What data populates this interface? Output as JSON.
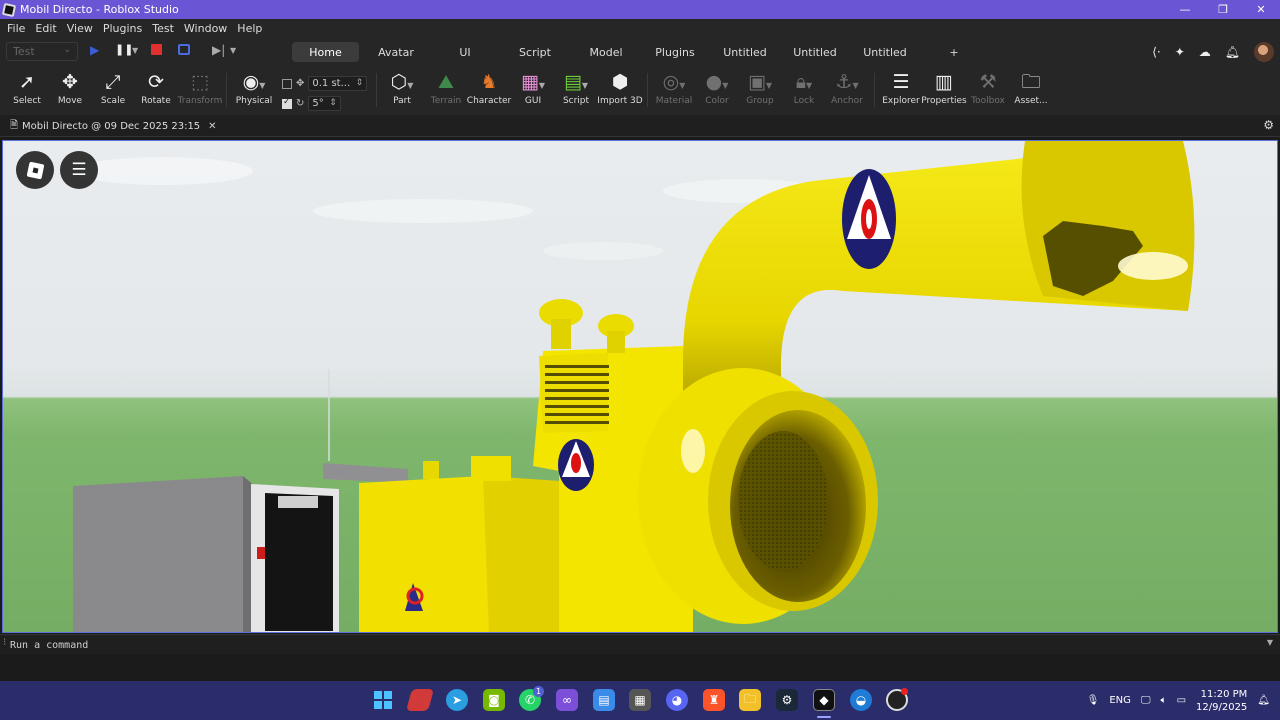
{
  "window": {
    "title": "Mobil Directo - Roblox Studio",
    "controls": {
      "minimize": "—",
      "maximize": "❐",
      "close": "✕"
    }
  },
  "menu": [
    "File",
    "Edit",
    "View",
    "Plugins",
    "Test",
    "Window",
    "Help"
  ],
  "tabbar": {
    "test_select": "Test",
    "tabs": [
      "Home",
      "Avatar",
      "UI",
      "Script",
      "Model",
      "Plugins",
      "Untitled",
      "Untitled",
      "Untitled"
    ],
    "active_tab": "Home",
    "add_tab": "+"
  },
  "toolbar": {
    "select": "Select",
    "move": "Move",
    "scale": "Scale",
    "rotate": "Rotate",
    "transform": "Transform",
    "physical": "Physical",
    "move_increment": "0.1 st...",
    "rotate_increment": "5°",
    "part": "Part",
    "terrain": "Terrain",
    "character": "Character",
    "gui": "GUI",
    "script": "Script",
    "import3d": "Import 3D",
    "material": "Material",
    "color": "Color",
    "group": "Group",
    "lock": "Lock",
    "anchor": "Anchor",
    "explorer": "Explorer",
    "properties": "Properties",
    "toolbox": "Toolbox",
    "assets": "Asset..."
  },
  "document": {
    "tab_label": "Mobil Directo @ 09 Dec 2025 23:15"
  },
  "command_bar": {
    "placeholder": "Run a command"
  },
  "taskbar": {
    "whatsapp_badge": "1",
    "language": "ENG",
    "time": "11:20 PM",
    "date": "12/9/2025"
  },
  "colors": {
    "title_bar": "#6a56d4",
    "taskbar": "#2b2d6a",
    "viewport_border": "#5b6fd8",
    "generator_yellow": "#f2e20a"
  }
}
